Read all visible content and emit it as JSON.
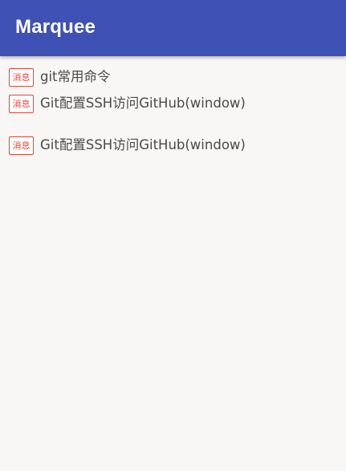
{
  "app_bar": {
    "title": "Marquee",
    "color": "#3f51b5"
  },
  "marquee": {
    "badge_color": "#e0453a",
    "items": [
      {
        "badge": "消息",
        "text": "git常用命令"
      },
      {
        "badge": "消息",
        "text": "Git配置SSH访问GitHub(window)"
      },
      {
        "badge": "消息",
        "text": "Git配置SSH访问GitHub(window)"
      }
    ]
  }
}
